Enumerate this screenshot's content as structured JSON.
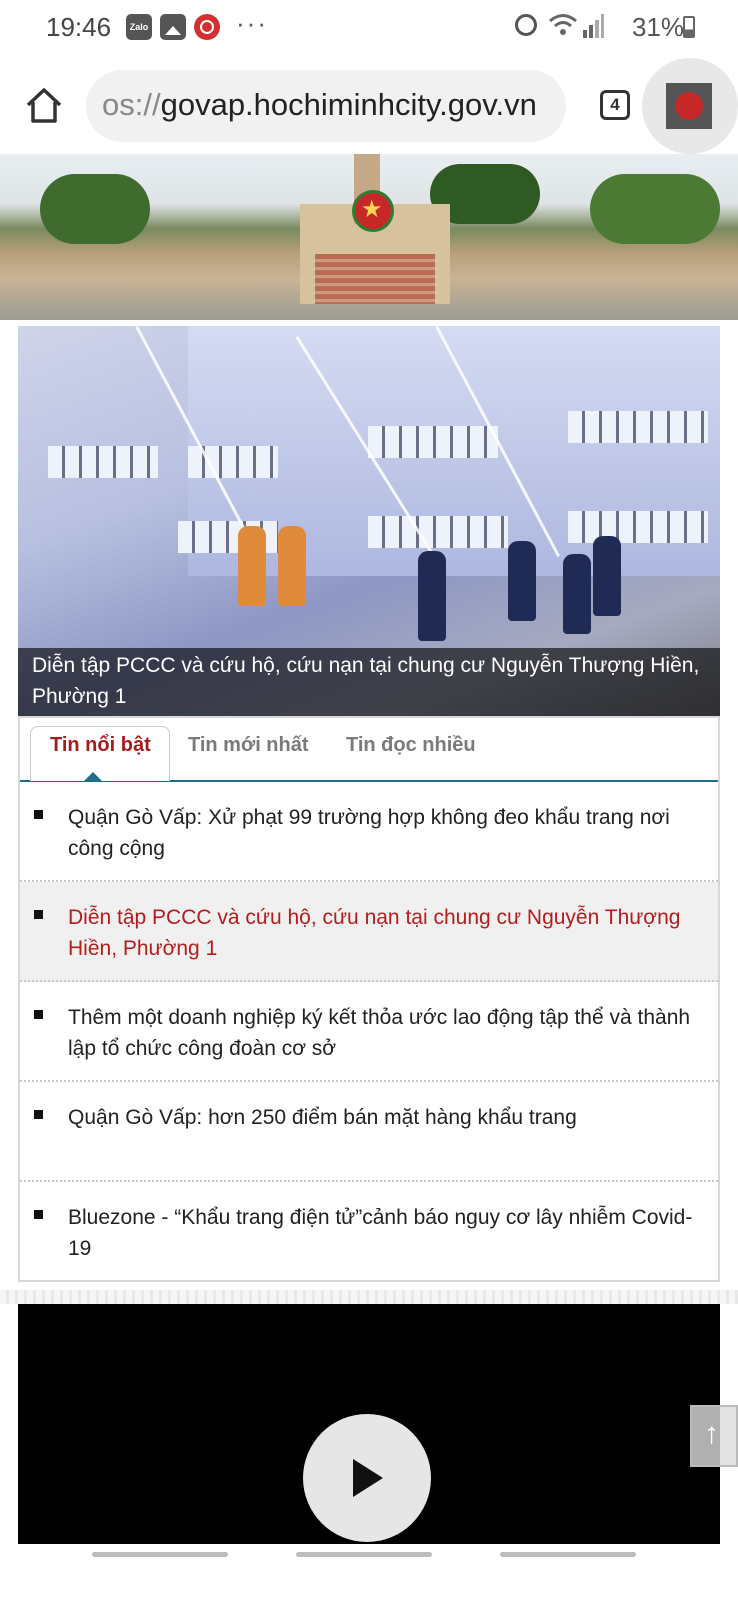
{
  "status_bar": {
    "time": "19:46",
    "zalo_label": "Zalo",
    "dots": "···",
    "battery": "31%"
  },
  "browser": {
    "url_prefix": "os://",
    "url_host": "govap.hochiminhcity.gov.vn",
    "tab_count": "4"
  },
  "feature": {
    "caption": "Diễn tập PCCC và cứu hộ, cứu nạn tại chung cư Nguyễn Thượng Hiền, Phường 1"
  },
  "news": {
    "tabs": [
      {
        "label": "Tin nổi bật",
        "active": true
      },
      {
        "label": "Tin mới nhất",
        "active": false
      },
      {
        "label": "Tin đọc nhiều",
        "active": false
      }
    ],
    "items": [
      {
        "text": "Quận Gò Vấp: Xử phạt 99 trường hợp không đeo khẩu trang nơi công cộng",
        "highlighted": false
      },
      {
        "text": "Diễn tập PCCC và cứu hộ, cứu nạn tại chung cư Nguyễn Thượng Hiền, Phường 1",
        "highlighted": true
      },
      {
        "text": "Thêm một doanh nghiệp ký kết thỏa ước lao động tập thể và thành lập tổ chức công đoàn cơ sở",
        "highlighted": false
      },
      {
        "text": "Quận Gò Vấp: hơn 250 điểm bán mặt hàng khẩu trang",
        "highlighted": false
      },
      {
        "text": "Bluezone - “Khẩu trang điện tử”cảnh báo nguy cơ lây nhiễm Covid-19",
        "highlighted": false
      }
    ]
  },
  "colors": {
    "active_tab": "#a31d1d",
    "highlight_text": "#b71c1c",
    "tab_underline": "#1f6e8c"
  },
  "icons": [
    "home-icon",
    "tabs-icon",
    "extension-icon",
    "play-icon",
    "arrow-up-icon",
    "alarm-icon",
    "wifi-icon",
    "signal-icon",
    "battery-icon"
  ]
}
